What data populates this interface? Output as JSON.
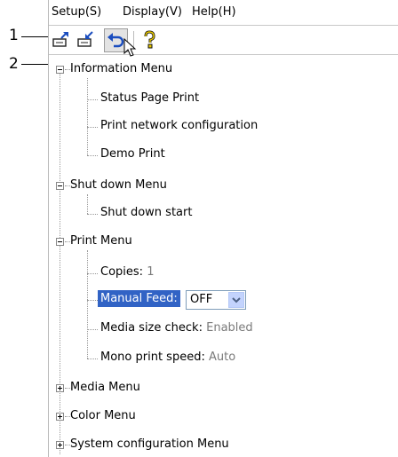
{
  "menubar": {
    "setup": "Setup(S)",
    "display": "Display(V)",
    "help": "Help(H)"
  },
  "toolbar": {
    "buttons": [
      {
        "icon": "upload-settings-icon"
      },
      {
        "icon": "download-settings-icon"
      },
      {
        "icon": "undo-icon"
      },
      {
        "icon": "help-icon"
      }
    ]
  },
  "callouts": [
    "1",
    "2"
  ],
  "tree": {
    "information_menu": {
      "label": "Information Menu",
      "children": [
        "Status Page Print",
        "Print network configuration",
        "Demo Print"
      ]
    },
    "shutdown_menu": {
      "label": "Shut down Menu",
      "children": [
        "Shut down start"
      ]
    },
    "print_menu": {
      "label": "Print Menu",
      "copies": {
        "label": "Copies:",
        "value": "1"
      },
      "manual_feed": {
        "label": "Manual Feed:",
        "value": "OFF"
      },
      "media_size_check": {
        "label": "Media size check:",
        "value": "Enabled"
      },
      "mono_print_speed": {
        "label": "Mono print speed:",
        "value": "Auto"
      }
    },
    "media_menu": {
      "label": "Media Menu"
    },
    "color_menu": {
      "label": "Color Menu"
    },
    "system_menu": {
      "label": "System configuration Menu"
    }
  },
  "colors": {
    "selection": "#3163c5",
    "tree_lines": "#999999"
  }
}
